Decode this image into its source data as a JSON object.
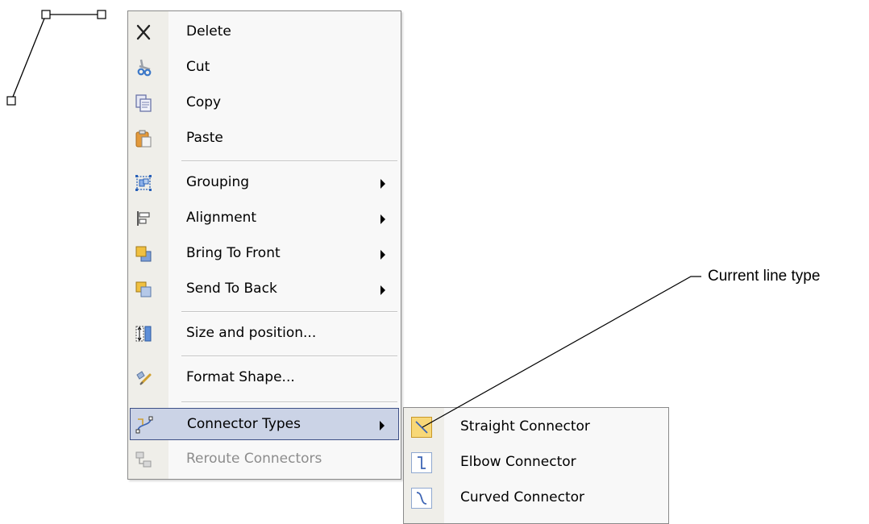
{
  "context_menu": {
    "items": [
      {
        "label": "Delete",
        "icon": "close-icon"
      },
      {
        "label": "Cut",
        "icon": "scissors-icon"
      },
      {
        "label": "Copy",
        "icon": "copy-icon"
      },
      {
        "label": "Paste",
        "icon": "paste-icon"
      },
      {
        "label": "Grouping",
        "icon": "grouping-icon",
        "submenu": true
      },
      {
        "label": "Alignment",
        "icon": "alignment-icon",
        "submenu": true
      },
      {
        "label": "Bring To Front",
        "icon": "bring-to-front-icon",
        "submenu": true
      },
      {
        "label": "Send To Back",
        "icon": "send-to-back-icon",
        "submenu": true
      },
      {
        "label": "Size and position...",
        "icon": "size-position-icon"
      },
      {
        "label": "Format Shape...",
        "icon": "format-shape-icon"
      },
      {
        "label": "Connector Types",
        "icon": "connector-types-icon",
        "submenu": true,
        "highlighted": true
      },
      {
        "label": "Reroute Connectors",
        "icon": "reroute-connectors-icon",
        "disabled": true
      }
    ]
  },
  "connector_submenu": {
    "items": [
      {
        "label": "Straight Connector",
        "icon": "straight-connector-icon",
        "checked": true
      },
      {
        "label": "Elbow Connector",
        "icon": "elbow-connector-icon"
      },
      {
        "label": "Curved Connector",
        "icon": "curved-connector-icon"
      }
    ]
  },
  "annotation": {
    "text": "Current line type"
  },
  "colors": {
    "highlight_bg": "#cbd3e6",
    "highlight_border": "#3d4f86",
    "checked_bg": "#f8d878",
    "disabled_text": "#8c8c8c"
  }
}
